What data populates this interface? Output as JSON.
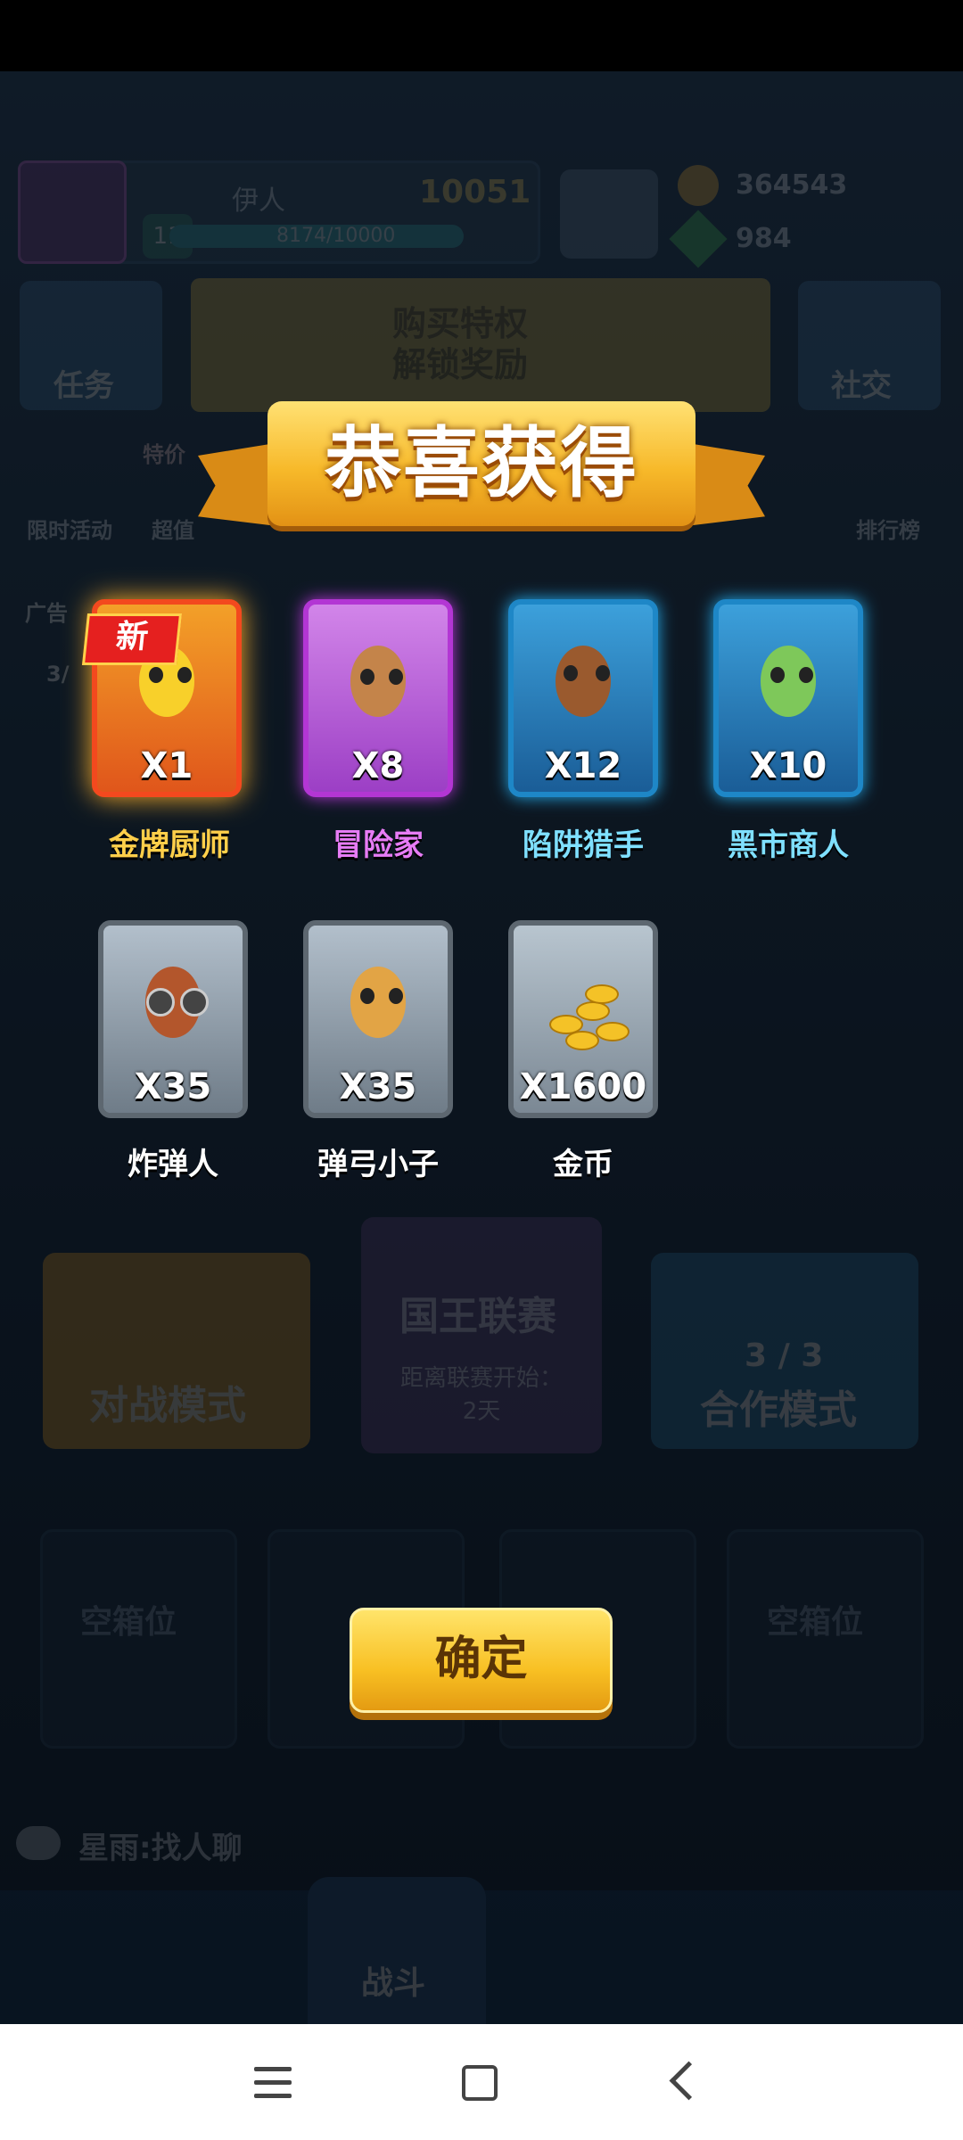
{
  "background": {
    "player_name": "伊人",
    "trophies": "10051",
    "level": "11",
    "xp": "8174/10000",
    "coins": "364543",
    "gems": "984",
    "task_label": "任务",
    "promo_text": "购买特权\n解锁奖励",
    "social_label": "社交",
    "limited_event_label": "限时活动",
    "super_label": "超值",
    "special_price_label": "特价",
    "ranking_label": "排行榜",
    "ad_label": "广告",
    "ad_count": "3/",
    "battle_mode_label": "对战模式",
    "king_league_label": "国王联赛",
    "king_league_sub": "距离联赛开始：\n2天",
    "coop_count": "3 / 3",
    "coop_mode_label": "合作模式",
    "empty_slot_label": "空箱位",
    "chat_text": "星雨:找人聊",
    "nav_battle_label": "战斗"
  },
  "dialog": {
    "title": "恭喜获得",
    "new_badge": "新",
    "rewards": [
      {
        "name": "金牌厨师",
        "qty": "X1",
        "rarity_color": "#f3491e",
        "name_color": "#ffcf4a"
      },
      {
        "name": "冒险家",
        "qty": "X8",
        "rarity_color": "#b336d4",
        "name_color": "#e77cf5"
      },
      {
        "name": "陷阱猎手",
        "qty": "X12",
        "rarity_color": "#1e87c7",
        "name_color": "#7fe0ff"
      },
      {
        "name": "黑市商人",
        "qty": "X10",
        "rarity_color": "#1e87c7",
        "name_color": "#7fe0ff"
      },
      {
        "name": "炸弹人",
        "qty": "X35",
        "rarity_color": "#5d6770",
        "name_color": "#ffffff"
      },
      {
        "name": "弹弓小子",
        "qty": "X35",
        "rarity_color": "#5d6770",
        "name_color": "#ffffff"
      },
      {
        "name": "金币",
        "qty": "X1600",
        "rarity_color": "#5d6770",
        "name_color": "#ffffff"
      }
    ],
    "confirm_label": "确定"
  },
  "system_nav": {
    "icons": [
      "menu-icon",
      "home-icon",
      "back-icon"
    ]
  }
}
